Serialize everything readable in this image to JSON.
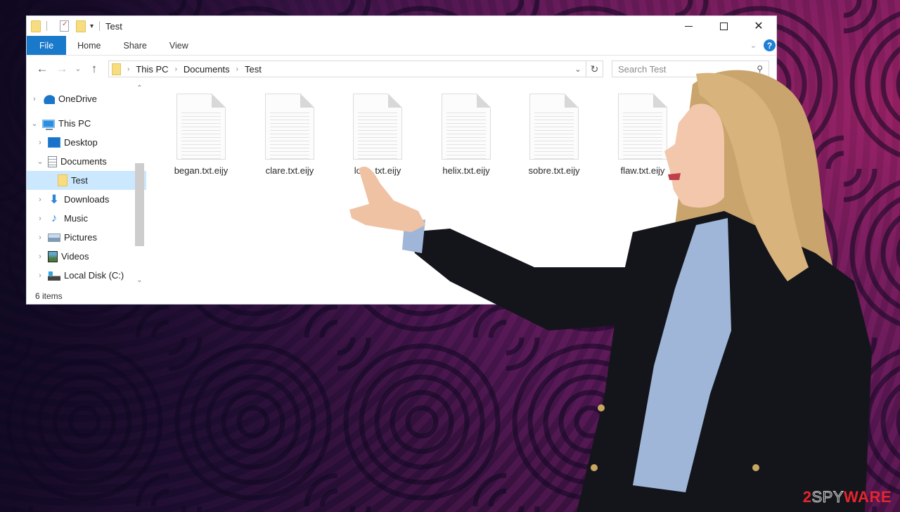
{
  "background": {
    "colors": {
      "dark": "#0c081e",
      "purple": "#3b1440",
      "magenta": "#c8287e"
    }
  },
  "window": {
    "title": "Test",
    "quick_access_dropdown": "▾",
    "controls": {
      "minimize": "minimize",
      "maximize": "maximize",
      "close": "✕"
    },
    "ribbon": {
      "tabs": [
        {
          "label": "File",
          "active": true
        },
        {
          "label": "Home"
        },
        {
          "label": "Share"
        },
        {
          "label": "View"
        }
      ],
      "expand_icon": "⌄",
      "help_icon": "?"
    },
    "nav": {
      "back": "←",
      "forward": "→",
      "recent": "⌄",
      "up": "↑",
      "breadcrumb": [
        "This PC",
        "Documents",
        "Test"
      ],
      "crumb_separator": "›",
      "address_dropdown": "⌄",
      "refresh": "↻",
      "search_placeholder": "Search Test",
      "search_icon": "⚲"
    },
    "sidebar": {
      "items": [
        {
          "label": "OneDrive",
          "icon": "onedrive-icon",
          "chevron": "›",
          "level": 0
        },
        {
          "label": "This PC",
          "icon": "pc-icon",
          "chevron": "⌄",
          "level": 0
        },
        {
          "label": "Desktop",
          "icon": "desktop-icon",
          "chevron": "›",
          "level": 1
        },
        {
          "label": "Documents",
          "icon": "documents-icon",
          "chevron": "⌄",
          "level": 1
        },
        {
          "label": "Test",
          "icon": "folder-icon",
          "chevron": "",
          "level": 2,
          "selected": true
        },
        {
          "label": "Downloads",
          "icon": "downloads-icon",
          "chevron": "›",
          "level": 1
        },
        {
          "label": "Music",
          "icon": "music-icon",
          "chevron": "›",
          "level": 1
        },
        {
          "label": "Pictures",
          "icon": "pictures-icon",
          "chevron": "›",
          "level": 1
        },
        {
          "label": "Videos",
          "icon": "videos-icon",
          "chevron": "›",
          "level": 1
        },
        {
          "label": "Local Disk (C:)",
          "icon": "disk-icon",
          "chevron": "›",
          "level": 1
        }
      ],
      "scroll_up": "⌃",
      "scroll_down": "⌄"
    },
    "files": [
      {
        "name": "began.txt.eijy"
      },
      {
        "name": "clare.txt.eijy"
      },
      {
        "name": "loc…txt.eijy"
      },
      {
        "name": "helix.txt.eijy"
      },
      {
        "name": "sobre.txt.eijy"
      },
      {
        "name": "flaw.txt.eijy"
      }
    ],
    "status": "6 items"
  },
  "watermark": {
    "part1": "2",
    "part2": "SPY",
    "part3": "WARE"
  }
}
